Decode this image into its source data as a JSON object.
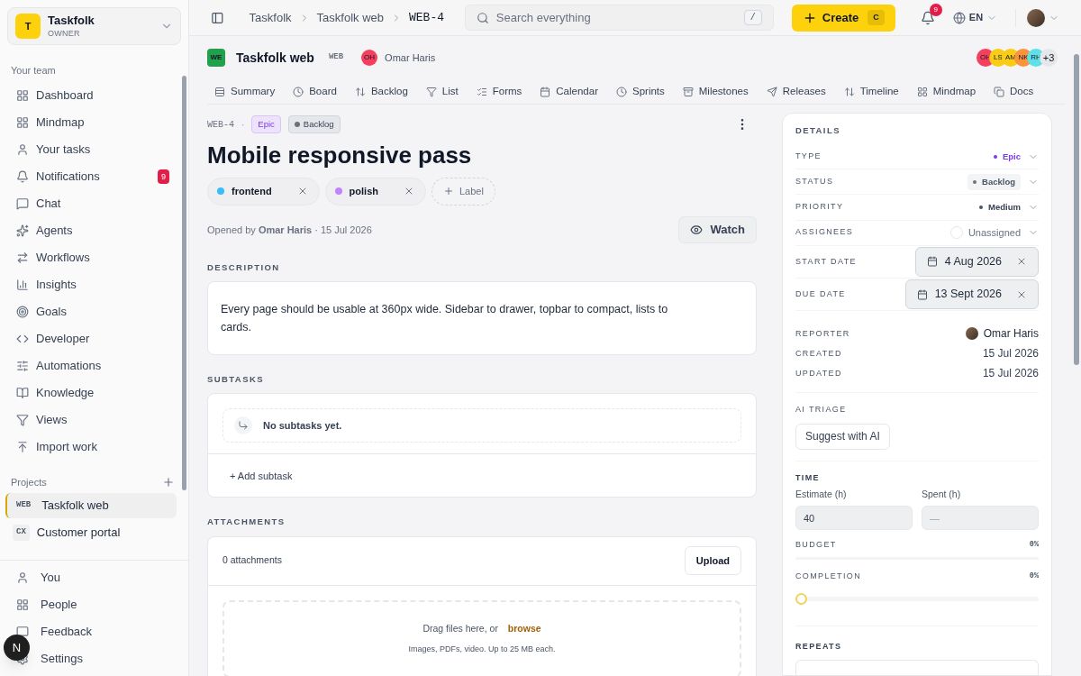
{
  "workspace": {
    "initial": "T",
    "name": "Taskfolk",
    "role": "OWNER"
  },
  "sidebar": {
    "section": "Your team",
    "items": [
      {
        "label": "Dashboard",
        "kind": "grid"
      },
      {
        "label": "Mindmap",
        "kind": "grid"
      },
      {
        "label": "Your tasks",
        "kind": "user"
      },
      {
        "label": "Notifications",
        "kind": "bell",
        "badge": "9"
      },
      {
        "label": "Chat",
        "kind": "chat"
      },
      {
        "label": "Agents",
        "kind": "sparkle"
      },
      {
        "label": "Workflows",
        "kind": "arrows"
      },
      {
        "label": "Insights",
        "kind": "chart"
      },
      {
        "label": "Goals",
        "kind": "goal"
      },
      {
        "label": "Developer",
        "kind": "code"
      },
      {
        "label": "Automations",
        "kind": "sliders"
      },
      {
        "label": "Knowledge",
        "kind": "book"
      },
      {
        "label": "Views",
        "kind": "filter"
      },
      {
        "label": "Import work",
        "kind": "import"
      }
    ],
    "projects_title": "Projects",
    "projects": [
      {
        "code": "WEB",
        "name": "Taskfolk web",
        "selected": true
      },
      {
        "code": "CX",
        "name": "Customer portal",
        "selected": false
      }
    ],
    "bottom": [
      {
        "label": "You",
        "kind": "user"
      },
      {
        "label": "People",
        "kind": "grid"
      },
      {
        "label": "Feedback",
        "kind": "chat"
      },
      {
        "label": "Settings",
        "kind": "gear"
      }
    ],
    "floating_button": "N"
  },
  "topbar": {
    "breadcrumbs": [
      "Taskfolk",
      "Taskfolk web",
      "WEB-4"
    ],
    "search": {
      "placeholder": "Search everything",
      "shortcut": "/"
    },
    "create": {
      "label": "Create",
      "shortcut": "C"
    },
    "notifications": "9",
    "language": "EN"
  },
  "project": {
    "icon": "WE",
    "name": "Taskfolk web",
    "code": "WEB",
    "owner_initials": "OH",
    "owner": "Omar Haris",
    "members": [
      {
        "initials": "OH",
        "color": "#f43f5e"
      },
      {
        "initials": "LS",
        "color": "#facc15"
      },
      {
        "initials": "AM",
        "color": "#facc15"
      },
      {
        "initials": "NK",
        "color": "#fb923c"
      },
      {
        "initials": "RH",
        "color": "#5ee0e6"
      }
    ],
    "more_members": "+3"
  },
  "tabs": [
    {
      "label": "Summary",
      "kind": "summary"
    },
    {
      "label": "Board",
      "kind": "clock"
    },
    {
      "label": "Backlog",
      "kind": "sort"
    },
    {
      "label": "List",
      "kind": "filter"
    },
    {
      "label": "Forms",
      "kind": "forms"
    },
    {
      "label": "Calendar",
      "kind": "calendar"
    },
    {
      "label": "Sprints",
      "kind": "clock"
    },
    {
      "label": "Milestones",
      "kind": "archive"
    },
    {
      "label": "Releases",
      "kind": "send"
    },
    {
      "label": "Timeline",
      "kind": "sort"
    },
    {
      "label": "Mindmap",
      "kind": "grid"
    },
    {
      "label": "Docs",
      "kind": "copy"
    }
  ],
  "issue": {
    "key": "WEB-4",
    "separator": "·",
    "type": "Epic",
    "status": "Backlog",
    "title": "Mobile responsive pass",
    "labels": [
      {
        "name": "frontend",
        "color": "#38bdf8"
      },
      {
        "name": "polish",
        "color": "#c084fc"
      }
    ],
    "add_label": "Label",
    "opened": "Opened by **Omar Haris** · 15 Jul 2026",
    "watch": "Watch",
    "description_title": "DESCRIPTION",
    "description": "Every page should be usable at 360px wide. Sidebar to drawer, topbar to compact, lists to cards.",
    "subtasks_title": "SUBTASKS",
    "subtasks_empty": "No subtasks yet.",
    "add_subtask": "+ Add subtask",
    "attachments_title": "ATTACHMENTS",
    "attachments_count": "0 attachments",
    "upload": "Upload",
    "drop_text": "Drag files here, or",
    "browse": "browse",
    "drop_hint": "Images, PDFs, video. Up to 25 MB each."
  },
  "details": {
    "title": "DETAILS",
    "rows": [
      {
        "label": "TYPE",
        "value": "Epic",
        "kind": "type"
      },
      {
        "label": "STATUS",
        "value": "Backlog",
        "kind": "status"
      },
      {
        "label": "PRIORITY",
        "value": "Medium",
        "kind": "priority"
      },
      {
        "label": "ASSIGNEES",
        "value": "Unassigned",
        "kind": "assignee"
      }
    ],
    "dates": [
      {
        "label": "START DATE",
        "value": "4 Aug 2026"
      },
      {
        "label": "DUE DATE",
        "value": "13 Sept 2026"
      }
    ],
    "reporter_label": "REPORTER",
    "reporter": "Omar Haris",
    "created_label": "CREATED",
    "created": "15 Jul 2026",
    "updated_label": "UPDATED",
    "updated": "15 Jul 2026",
    "ai_title": "AI TRIAGE",
    "ai_button": "Suggest with AI",
    "time_title": "TIME",
    "estimate_label": "Estimate (h)",
    "estimate": "40",
    "spent_label": "Spent (h)",
    "spent_placeholder": "—",
    "budget": {
      "label": "BUDGET",
      "reading": "0%",
      "level": 0
    },
    "completion": {
      "label": "COMPLETION",
      "reading": "0%",
      "level": 0
    },
    "repeats_title": "REPEATS"
  }
}
